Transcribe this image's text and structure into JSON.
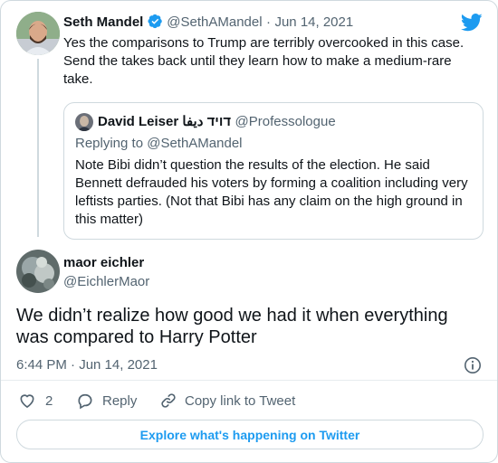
{
  "thread_tweet": {
    "author_name": "Seth Mandel",
    "handle": "@SethAMandel",
    "separator": "·",
    "date": "Jun 14, 2021",
    "text": "Yes the comparisons to Trump are terribly overcooked in this case. Send the takes back until they learn how to make a medium-rare take."
  },
  "quoted_tweet": {
    "author_name": "David Leiser דויד ديفا",
    "handle": "@Professologue",
    "replying_to": "Replying to @SethAMandel",
    "text": "Note Bibi didn’t question the results of the election.  He said Bennett defrauded his voters by forming a coalition including very leftists parties. (Not that Bibi has any claim on the high ground in this matter)"
  },
  "main_tweet": {
    "author_name": "maor eichler",
    "handle": "@EichlerMaor",
    "text": "We didn’t realize how good we had it when everything was compared to Harry Potter",
    "timestamp": "6:44 PM · Jun 14, 2021"
  },
  "actions": {
    "like_count": "2",
    "reply_label": "Reply",
    "copy_link_label": "Copy link to Tweet"
  },
  "explore_label": "Explore what's happening on Twitter",
  "colors": {
    "twitter_blue": "#1d9bf0",
    "text": "#0f1419",
    "muted": "#536471",
    "border": "#cfd9de"
  },
  "icons": {
    "brand": "twitter-bird-icon",
    "verified": "verified-badge-icon",
    "info": "info-icon",
    "like": "heart-icon",
    "reply": "speech-bubble-icon",
    "copy_link": "link-icon"
  }
}
